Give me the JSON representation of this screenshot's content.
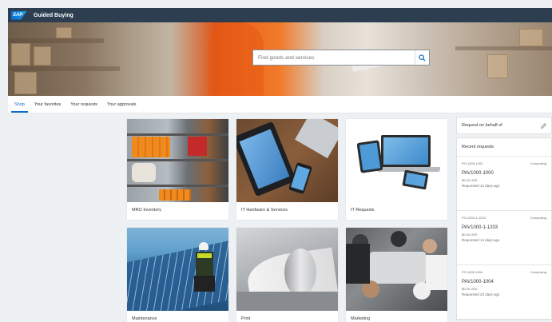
{
  "app": {
    "logo": "SAP",
    "title": "Guided Buying"
  },
  "search": {
    "placeholder": "Find goods and services",
    "icon": "search-icon"
  },
  "tabs": [
    {
      "label": "Shop",
      "active": true
    },
    {
      "label": "Your favorites",
      "active": false
    },
    {
      "label": "Your requests",
      "active": false
    },
    {
      "label": "Your approvals",
      "active": false
    }
  ],
  "tiles": [
    {
      "label": "MRO Inventory"
    },
    {
      "label": "IT Hardware & Services"
    },
    {
      "label": "IT Requests"
    },
    {
      "label": "Maintenance"
    },
    {
      "label": "Print"
    },
    {
      "label": "Marketing"
    }
  ],
  "sidebar": {
    "on_behalf_label": "Request on behalf of",
    "recent_title": "Recent requests",
    "requests": [
      {
        "code": "PO-1000-1203",
        "status": "Composing",
        "id": "PAV1000-1000",
        "amount": "$0.00 USD",
        "when": "Requested 14 days ago"
      },
      {
        "code": "PO-1000-1-1203",
        "status": "Composing",
        "id": "PAV1000-1-1203",
        "amount": "$0.00 USD",
        "when": "Requested 14 days ago"
      },
      {
        "code": "PO-1000-1004",
        "status": "Composing",
        "id": "PAV1000-1004",
        "amount": "$0.00 USD",
        "when": "Requested 23 days ago"
      }
    ]
  },
  "colors": {
    "shell": "#2c3e50",
    "accent": "#0a6ed1",
    "background": "#eef1f4"
  }
}
